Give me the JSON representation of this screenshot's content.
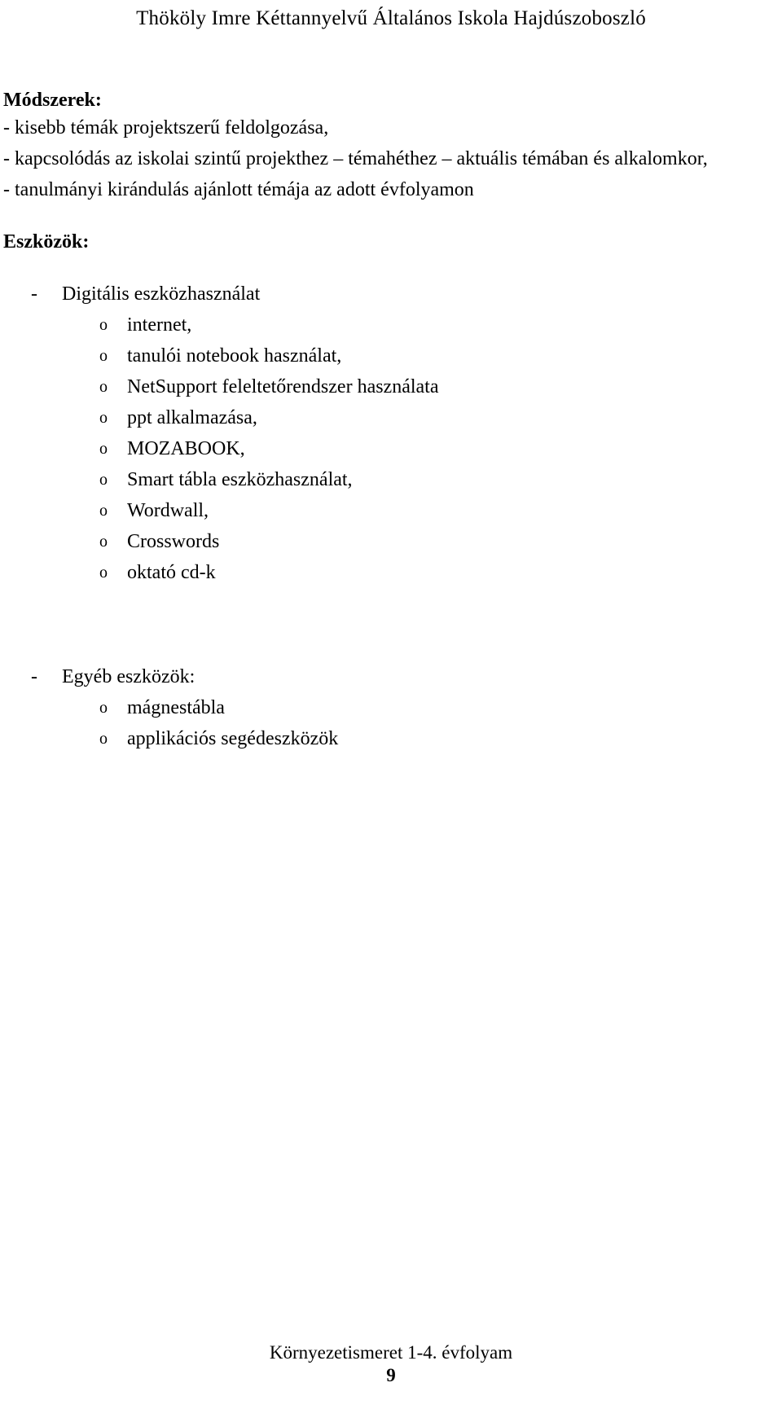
{
  "header": {
    "school_name": "Thököly Imre Kéttannyelvű Általános Iskola Hajdúszoboszló"
  },
  "methods": {
    "heading": "Módszerek:",
    "items": [
      "- kisebb témák projektszerű feldolgozása,",
      "- kapcsolódás az iskolai szintű projekthez – témahéthez – aktuális témában és alkalomkor,",
      "- tanulmányi kirándulás ajánlott témája az adott évfolyamon"
    ]
  },
  "tools": {
    "heading": "Eszközök:",
    "groups": [
      {
        "marker": "-",
        "label": "Digitális eszközhasználat",
        "sub_marker": "o",
        "sub_items": [
          "internet,",
          "tanulói notebook használat,",
          "NetSupport feleltetőrendszer használata",
          "ppt alkalmazása,",
          "MOZABOOK,",
          "Smart tábla eszközhasználat,",
          "Wordwall,",
          "Crosswords",
          "oktató cd-k"
        ]
      },
      {
        "marker": "-",
        "label": "Egyéb eszközök:",
        "sub_marker": "o",
        "sub_items": [
          "mágnestábla",
          "applikációs segédeszközök"
        ]
      }
    ]
  },
  "footer": {
    "subject": "Környezetismeret 1-4. évfolyam",
    "page_number": "9"
  },
  "colors": {
    "text": "#000000",
    "background": "#ffffff"
  }
}
